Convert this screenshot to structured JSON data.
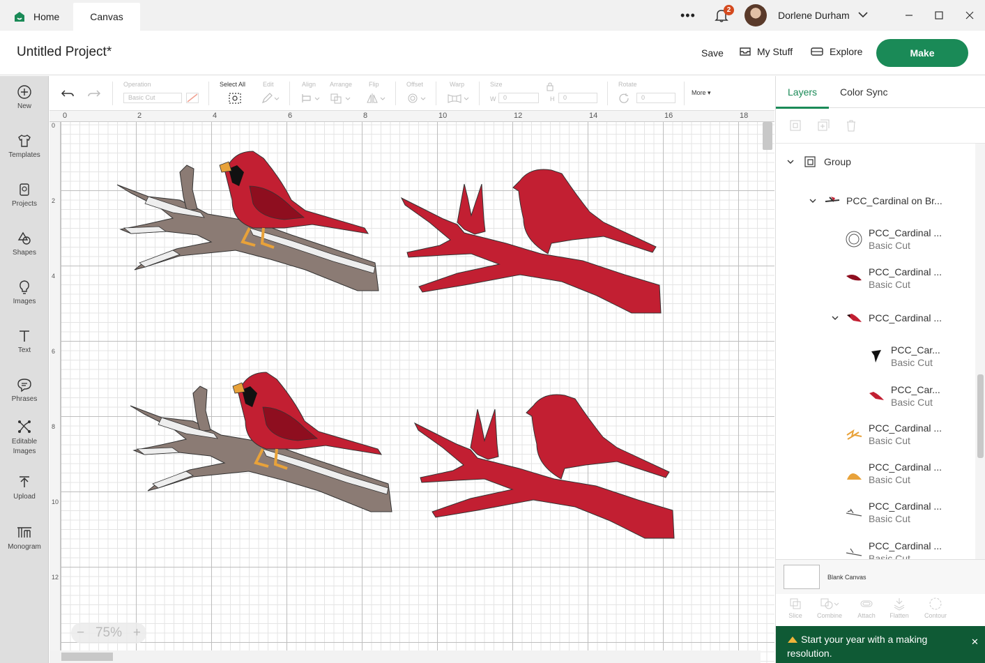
{
  "tabs": {
    "home": "Home",
    "canvas": "Canvas"
  },
  "topbar": {
    "more": "•••",
    "notifications_count": "2",
    "user_name": "Dorlene Durham"
  },
  "header": {
    "project_title": "Untitled Project*",
    "save": "Save",
    "my_stuff": "My Stuff",
    "explore": "Explore",
    "make": "Make"
  },
  "sidebar": {
    "items": [
      {
        "label": "New",
        "icon": "plus-circle-icon"
      },
      {
        "label": "Templates",
        "icon": "shirt-icon"
      },
      {
        "label": "Projects",
        "icon": "projects-icon"
      },
      {
        "label": "Shapes",
        "icon": "shapes-icon"
      },
      {
        "label": "Images",
        "icon": "lightbulb-icon"
      },
      {
        "label": "Text",
        "icon": "text-icon"
      },
      {
        "label": "Phrases",
        "icon": "speech-bubble-icon"
      },
      {
        "label": "Editable Images",
        "icon": "editable-images-icon"
      },
      {
        "label": "Upload",
        "icon": "upload-icon"
      },
      {
        "label": "Monogram",
        "icon": "monogram-icon"
      }
    ]
  },
  "toolbar": {
    "operation_label": "Operation",
    "operation_value": "Basic Cut",
    "select_all": "Select All",
    "edit": "Edit",
    "align": "Align",
    "arrange": "Arrange",
    "flip": "Flip",
    "offset": "Offset",
    "warp": "Warp",
    "size": "Size",
    "w": "W",
    "h": "H",
    "w_value": "0",
    "h_value": "0",
    "rotate": "Rotate",
    "rotate_value": "0",
    "more": "More"
  },
  "ruler": {
    "top": [
      "0",
      "2",
      "4",
      "6",
      "8",
      "10",
      "12",
      "14",
      "16",
      "18"
    ],
    "left": [
      "0",
      "2",
      "4",
      "6",
      "8",
      "10",
      "12"
    ]
  },
  "zoom": {
    "level": "75%",
    "minus": "−",
    "plus": "+"
  },
  "panel": {
    "tab_layers": "Layers",
    "tab_color_sync": "Color Sync",
    "layers": [
      {
        "name": "Group",
        "sub": ""
      },
      {
        "name": "PCC_Cardinal on Br...",
        "sub": ""
      },
      {
        "name": "PCC_Cardinal ...",
        "sub": "Basic Cut"
      },
      {
        "name": "PCC_Cardinal ...",
        "sub": "Basic Cut"
      },
      {
        "name": "PCC_Cardinal ...",
        "sub": ""
      },
      {
        "name": "PCC_Car...",
        "sub": "Basic Cut"
      },
      {
        "name": "PCC_Car...",
        "sub": "Basic Cut"
      },
      {
        "name": "PCC_Cardinal ...",
        "sub": "Basic Cut"
      },
      {
        "name": "PCC_Cardinal ...",
        "sub": "Basic Cut"
      },
      {
        "name": "PCC_Cardinal ...",
        "sub": "Basic Cut"
      },
      {
        "name": "PCC_Cardinal ...",
        "sub": "Basic Cut"
      }
    ],
    "blank_canvas": "Blank Canvas",
    "bottom_tools": [
      "Slice",
      "Combine",
      "Attach",
      "Flatten",
      "Contour"
    ],
    "promo_text": "Start your year with a making resolution.",
    "promo_close": "✕"
  },
  "colors": {
    "brand_green": "#1a8a57",
    "cardinal_red": "#c21f32",
    "branch_brown": "#8b7b74"
  }
}
